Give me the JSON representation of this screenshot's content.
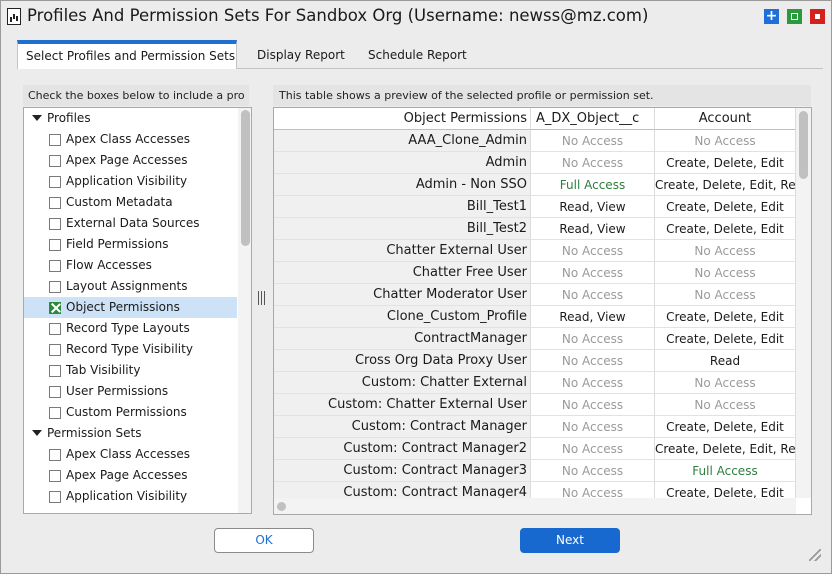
{
  "window": {
    "title": "Profiles And Permission Sets For Sandbox Org (Username: newss@mz.com)",
    "controls": [
      "plus",
      "maximize",
      "close"
    ]
  },
  "tabs": [
    {
      "label": "Select Profiles and Permission Sets",
      "active": true
    },
    {
      "label": "Display Report",
      "active": false
    },
    {
      "label": "Schedule Report",
      "active": false
    }
  ],
  "left_panel": {
    "instruction": "Check the boxes below to include a pro",
    "tree": [
      {
        "type": "group",
        "label": "Profiles",
        "expanded": true
      },
      {
        "type": "item",
        "label": "Apex Class Accesses",
        "checked": false
      },
      {
        "type": "item",
        "label": "Apex Page Accesses",
        "checked": false
      },
      {
        "type": "item",
        "label": "Application Visibility",
        "checked": false
      },
      {
        "type": "item",
        "label": "Custom Metadata",
        "checked": false
      },
      {
        "type": "item",
        "label": "External Data Sources",
        "checked": false
      },
      {
        "type": "item",
        "label": "Field Permissions",
        "checked": false
      },
      {
        "type": "item",
        "label": "Flow Accesses",
        "checked": false
      },
      {
        "type": "item",
        "label": "Layout Assignments",
        "checked": false
      },
      {
        "type": "item",
        "label": "Object Permissions",
        "checked": true,
        "selected": true
      },
      {
        "type": "item",
        "label": "Record Type Layouts",
        "checked": false
      },
      {
        "type": "item",
        "label": "Record Type Visibility",
        "checked": false
      },
      {
        "type": "item",
        "label": "Tab Visibility",
        "checked": false
      },
      {
        "type": "item",
        "label": "User Permissions",
        "checked": false
      },
      {
        "type": "item",
        "label": "Custom Permissions",
        "checked": false
      },
      {
        "type": "group",
        "label": "Permission Sets",
        "expanded": true
      },
      {
        "type": "item",
        "label": "Apex Class Accesses",
        "checked": false
      },
      {
        "type": "item",
        "label": "Apex Page Accesses",
        "checked": false
      },
      {
        "type": "item",
        "label": "Application Visibility",
        "checked": false
      }
    ]
  },
  "right_panel": {
    "instruction": "This table shows a preview of the selected profile or permission set.",
    "columns": [
      "Object Permissions",
      "A_DX_Object__c",
      "Account"
    ],
    "rows": [
      {
        "name": "AAA_Clone_Admin",
        "col1": "No Access",
        "col2": "No Access"
      },
      {
        "name": "Admin",
        "col1": "No Access",
        "col2": "Create, Delete, Edit"
      },
      {
        "name": "Admin - Non SSO",
        "col1": "Full Access",
        "col2": "Create, Delete, Edit, Re"
      },
      {
        "name": "Bill_Test1",
        "col1": "Read, View",
        "col2": "Create, Delete, Edit"
      },
      {
        "name": "Bill_Test2",
        "col1": "Read, View",
        "col2": "Create, Delete, Edit"
      },
      {
        "name": "Chatter External User",
        "col1": "No Access",
        "col2": "No Access"
      },
      {
        "name": "Chatter Free User",
        "col1": "No Access",
        "col2": "No Access"
      },
      {
        "name": "Chatter Moderator User",
        "col1": "No Access",
        "col2": "No Access"
      },
      {
        "name": "Clone_Custom_Profile",
        "col1": "Read, View",
        "col2": "Create, Delete, Edit"
      },
      {
        "name": "ContractManager",
        "col1": "No Access",
        "col2": "Create, Delete, Edit"
      },
      {
        "name": "Cross Org Data Proxy User",
        "col1": "No Access",
        "col2": "Read"
      },
      {
        "name": "Custom: Chatter External",
        "col1": "No Access",
        "col2": "No Access"
      },
      {
        "name": "Custom: Chatter External User",
        "col1": "No Access",
        "col2": "No Access"
      },
      {
        "name": "Custom: Contract Manager",
        "col1": "No Access",
        "col2": "Create, Delete, Edit"
      },
      {
        "name": "Custom: Contract Manager2",
        "col1": "No Access",
        "col2": "Create, Delete, Edit, Re"
      },
      {
        "name": "Custom: Contract Manager3",
        "col1": "No Access",
        "col2": "Full Access"
      },
      {
        "name": "Custom: Contract Manager4",
        "col1": "No Access",
        "col2": "Create, Delete, Edit"
      }
    ]
  },
  "footer": {
    "ok_label": "OK",
    "next_label": "Next"
  },
  "colors": {
    "accent": "#1769cf",
    "full_access": "#2e7d3c",
    "no_access": "#9a9a9a",
    "selected_row": "#cde2f6"
  }
}
